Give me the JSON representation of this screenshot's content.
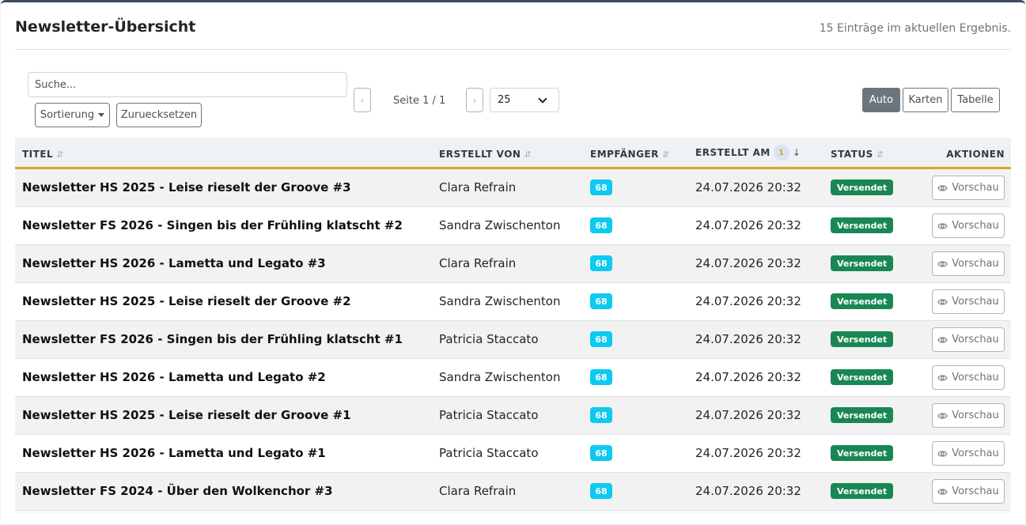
{
  "header": {
    "title": "Newsletter-Übersicht",
    "result_count": "15 Einträge im aktuellen Ergebnis."
  },
  "toolbar": {
    "search_placeholder": "Suche...",
    "sort_label": "Sortierung",
    "reset_label": "Zuruecksetzen",
    "prev_label": "‹",
    "next_label": "›",
    "page_info": "Seite 1 / 1",
    "page_size": "25",
    "view_modes": [
      "Auto",
      "Karten",
      "Tabelle"
    ],
    "active_view": "Auto"
  },
  "table": {
    "columns": {
      "title": "TITEL",
      "author": "ERSTELLT VON",
      "recipients": "EMPFÄNGER",
      "created": "ERSTELLT AM",
      "created_sort_order": "1",
      "status": "STATUS",
      "actions": "AKTIONEN"
    },
    "rows": [
      {
        "title": "Newsletter HS 2025 - Leise rieselt der Groove #3",
        "author": "Clara Refrain",
        "recipients": "68",
        "created": "24.07.2026 20:32",
        "status": "Versendet",
        "action": "Vorschau"
      },
      {
        "title": "Newsletter FS 2026 - Singen bis der Frühling klatscht #2",
        "author": "Sandra Zwischenton",
        "recipients": "68",
        "created": "24.07.2026 20:32",
        "status": "Versendet",
        "action": "Vorschau"
      },
      {
        "title": "Newsletter HS 2026 - Lametta und Legato #3",
        "author": "Clara Refrain",
        "recipients": "68",
        "created": "24.07.2026 20:32",
        "status": "Versendet",
        "action": "Vorschau"
      },
      {
        "title": "Newsletter HS 2025 - Leise rieselt der Groove #2",
        "author": "Sandra Zwischenton",
        "recipients": "68",
        "created": "24.07.2026 20:32",
        "status": "Versendet",
        "action": "Vorschau"
      },
      {
        "title": "Newsletter FS 2026 - Singen bis der Frühling klatscht #1",
        "author": "Patricia Staccato",
        "recipients": "68",
        "created": "24.07.2026 20:32",
        "status": "Versendet",
        "action": "Vorschau"
      },
      {
        "title": "Newsletter HS 2026 - Lametta und Legato #2",
        "author": "Sandra Zwischenton",
        "recipients": "68",
        "created": "24.07.2026 20:32",
        "status": "Versendet",
        "action": "Vorschau"
      },
      {
        "title": "Newsletter HS 2025 - Leise rieselt der Groove #1",
        "author": "Patricia Staccato",
        "recipients": "68",
        "created": "24.07.2026 20:32",
        "status": "Versendet",
        "action": "Vorschau"
      },
      {
        "title": "Newsletter HS 2026 - Lametta und Legato #1",
        "author": "Patricia Staccato",
        "recipients": "68",
        "created": "24.07.2026 20:32",
        "status": "Versendet",
        "action": "Vorschau"
      },
      {
        "title": "Newsletter FS 2024 - Über den Wolkenchor #3",
        "author": "Clara Refrain",
        "recipients": "68",
        "created": "24.07.2026 20:32",
        "status": "Versendet",
        "action": "Vorschau"
      }
    ]
  },
  "colors": {
    "accent": "#e0a526",
    "recipients_badge": "#0dcaf0",
    "status_sent": "#198754",
    "active_view": "#6c757d"
  },
  "icons": {
    "sortable": "sort-arrows-icon",
    "sort_desc": "arrow-down-icon",
    "preview": "eye-icon",
    "dropdown": "caret-down-icon",
    "select": "chevron-down-icon"
  }
}
